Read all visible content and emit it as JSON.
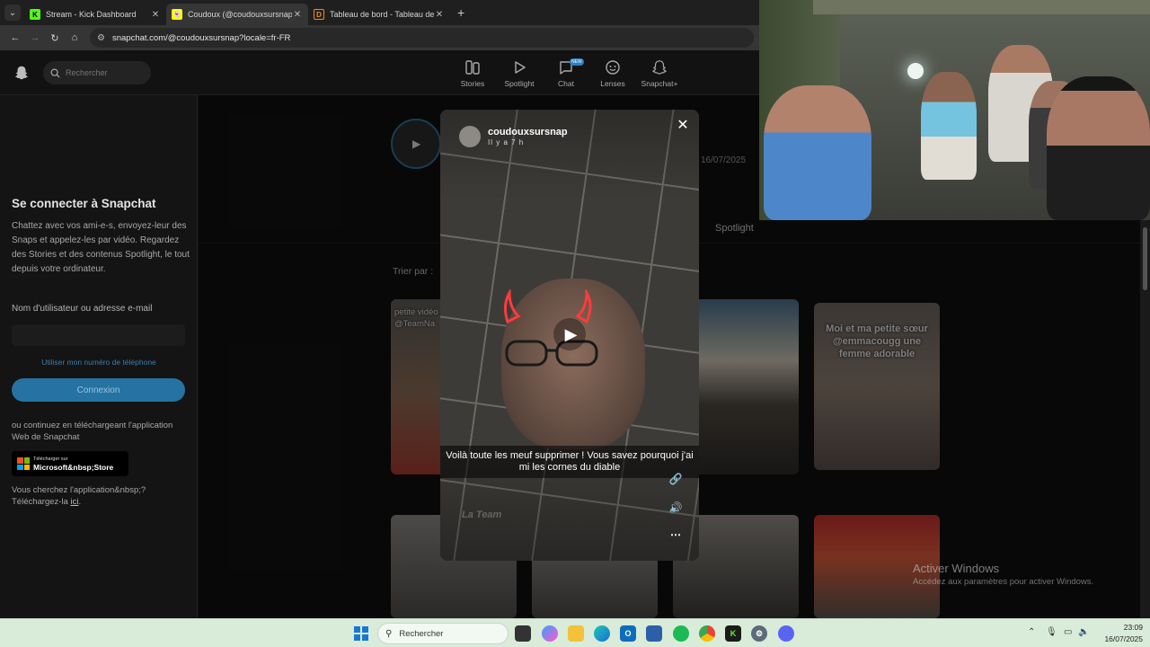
{
  "browser": {
    "tabs": [
      {
        "title": "Stream - Kick Dashboard",
        "favicon": "K",
        "color": "#53fc18"
      },
      {
        "title": "Coudoux (@coudouxsursnap) |",
        "favicon": "👻",
        "color": "#fffc00"
      },
      {
        "title": "Tableau de bord - Tableau de b",
        "favicon": "D",
        "color": "#f08a24"
      }
    ],
    "url": "snapchat.com/@coudouxsursnap?locale=fr-FR"
  },
  "snap": {
    "search_placeholder": "Rechercher",
    "nav": [
      {
        "label": "Stories",
        "icon": "stories-icon"
      },
      {
        "label": "Spotlight",
        "icon": "spotlight-icon"
      },
      {
        "label": "Chat",
        "icon": "chat-icon",
        "badge": "NEW"
      },
      {
        "label": "Lenses",
        "icon": "lenses-icon"
      },
      {
        "label": "Snapchat+",
        "icon": "snapchat-plus-icon"
      }
    ]
  },
  "login": {
    "title": "Se connecter à Snapchat",
    "description": "Chattez avec vos ami-e-s, envoyez-leur des Snaps et appelez-les par vidéo. Regardez des Stories et des contenus Spotlight, le tout depuis votre ordinateur.",
    "username_label": "Nom d'utilisateur ou adresse e-mail",
    "phone_link": "Utiliser mon numéro de téléphone",
    "login_button": "Connexion",
    "download_text": "ou continuez en téléchargeant l'application Web de Snapchat",
    "store_small": "Télécharger sur",
    "store_big": "Microsoft&nbsp;Store",
    "app_text_prefix": "Vous cherchez l'application&nbsp;? Téléchargez-la ",
    "app_link": "ici",
    "app_text_suffix": "."
  },
  "profile": {
    "date": "16/07/2025",
    "spotlight_tab": "Spotlight",
    "sort_label": "Trier par :"
  },
  "cards": {
    "c1_caption": "petite vidéo\n@TeamNa",
    "c4_caption": "Moi et ma petite sœur @emmacougg une femme adorable"
  },
  "modal": {
    "username": "coudouxsursnap",
    "time": "Il y a 7 h",
    "caption": "Voilà toute les meuf supprimer ! Vous savez pourquoi j'ai mi les cornes du diable",
    "watermark": "La Team"
  },
  "windows": {
    "activate_title": "Activer Windows",
    "activate_sub": "Accédez aux paramètres pour activer Windows.",
    "search": "Rechercher",
    "time": "23:09",
    "date": "16/07/2025"
  }
}
